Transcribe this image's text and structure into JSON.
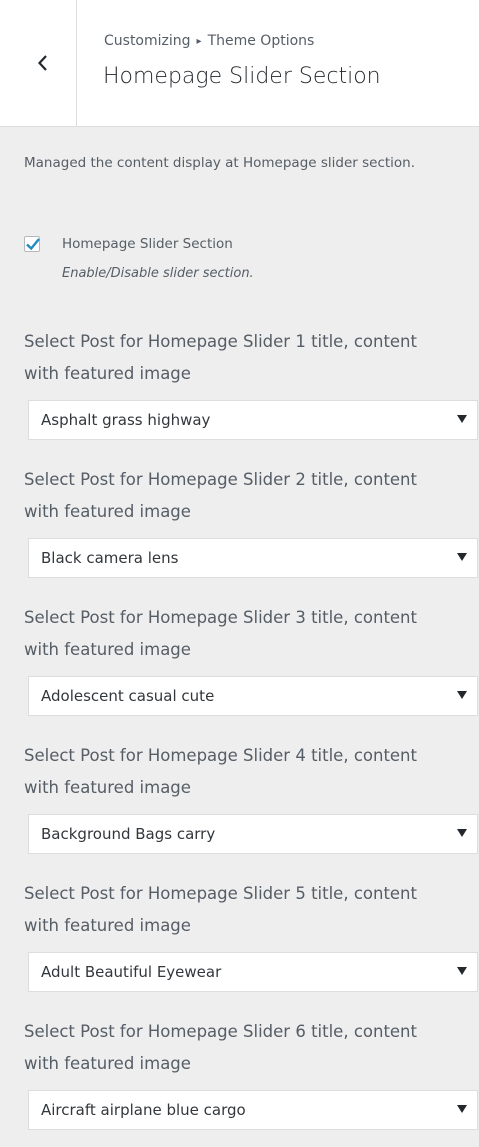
{
  "header": {
    "breadcrumb_parent": "Customizing",
    "breadcrumb_child": "Theme Options",
    "separator": "▸",
    "title": "Homepage Slider Section"
  },
  "description": "Managed the content display at Homepage slider section.",
  "enable_checkbox": {
    "checked": true,
    "label": "Homepage Slider Section",
    "sublabel": "Enable/Disable slider section."
  },
  "fields": [
    {
      "label_line1": "Select Post for Homepage Slider 1 title, content",
      "label_line2": "with featured image",
      "value": "Asphalt grass highway"
    },
    {
      "label_line1": "Select Post for Homepage Slider 2 title, content",
      "label_line2": "with featured image",
      "value": "Black camera lens"
    },
    {
      "label_line1": "Select Post for Homepage Slider 3 title, content",
      "label_line2": "with featured image",
      "value": "Adolescent casual cute"
    },
    {
      "label_line1": "Select Post for Homepage Slider 4 title, content",
      "label_line2": "with featured image",
      "value": "Background Bags carry"
    },
    {
      "label_line1": "Select Post for Homepage Slider 5 title, content",
      "label_line2": "with featured image",
      "value": "Adult Beautiful Eyewear"
    },
    {
      "label_line1": "Select Post for Homepage Slider 6 title, content",
      "label_line2": "with featured image",
      "value": "Aircraft airplane blue cargo"
    }
  ],
  "colors": {
    "accent": "#0073aa",
    "panel_bg": "#eeeeee",
    "header_bg": "#ffffff"
  }
}
